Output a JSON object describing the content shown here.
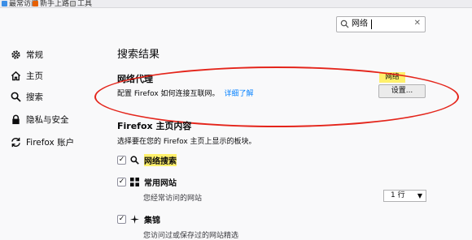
{
  "bookmarks": [
    "最常访问",
    "新手上路",
    "工具"
  ],
  "search": {
    "value": "网络"
  },
  "sidebar": {
    "items": [
      {
        "label": "常规",
        "icon": "gear-icon"
      },
      {
        "label": "主页",
        "icon": "home-icon"
      },
      {
        "label": "搜索",
        "icon": "search-icon"
      },
      {
        "label": "隐私与安全",
        "icon": "lock-icon"
      },
      {
        "label": "Firefox 账户",
        "icon": "sync-icon"
      }
    ]
  },
  "results": {
    "heading": "搜索结果",
    "proxy": {
      "title": "网络代理",
      "description": "配置 Firefox 如何连接互联网。",
      "learn_more": "详细了解",
      "badge": "网络",
      "settings_button": "设置..."
    }
  },
  "home_content": {
    "title": "Firefox 主页内容",
    "description": "选择要在您的 Firefox 主页上显示的板块。",
    "options": [
      {
        "label": "网络搜索",
        "checked": true,
        "icon": "search-icon",
        "highlighted": true
      },
      {
        "label": "常用网站",
        "checked": true,
        "icon": "grid-icon",
        "sublabel": "您经常访问的网站",
        "select_value": "1 行"
      },
      {
        "label": "集锦",
        "checked": true,
        "icon": "sparkle-icon",
        "sublabel": "您访问过或保存过的网站精选"
      }
    ]
  },
  "colors": {
    "highlight": "#fff06b",
    "annotation": "#e4251b",
    "link": "#0a84ff"
  }
}
